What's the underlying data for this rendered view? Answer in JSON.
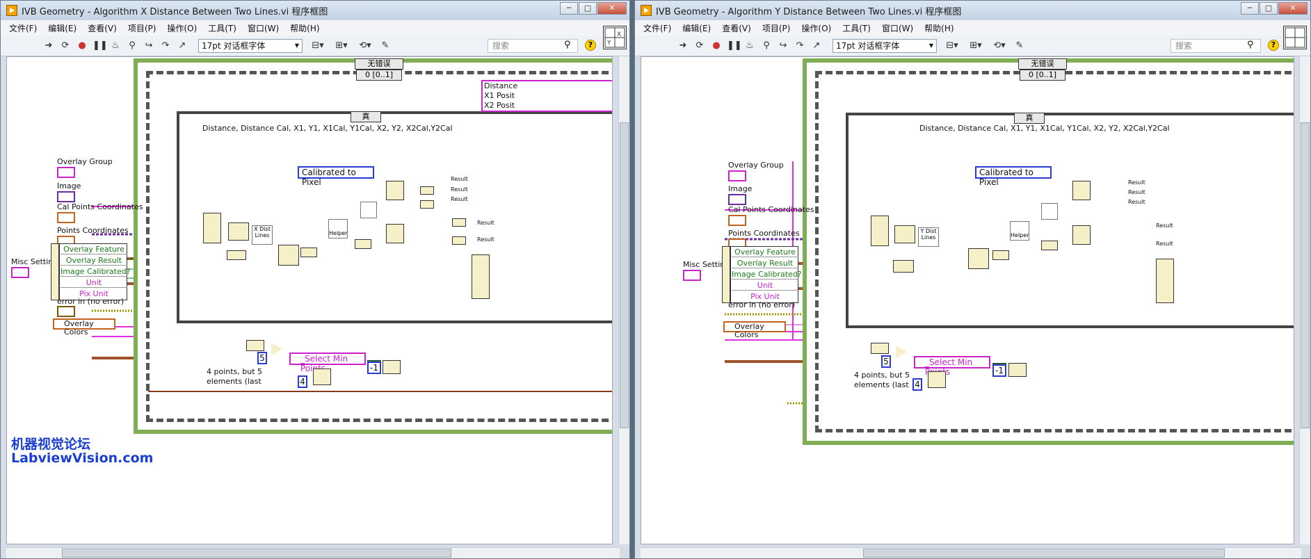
{
  "left": {
    "title": "IVB Geometry - Algorithm X Distance Between Two Lines.vi 程序框图",
    "dist_node_label": "X Dist Lines",
    "right_indicators": [
      "Distance",
      "X1 Posit",
      "X2 Posit"
    ]
  },
  "right": {
    "title": "IVB Geometry - Algorithm Y Distance Between Two Lines.vi 程序框图",
    "dist_node_label": "Y Dist Lines"
  },
  "window_buttons": {
    "minimize": "─",
    "maximize": "□",
    "close": "✕"
  },
  "menu": [
    "文件(F)",
    "编辑(E)",
    "查看(V)",
    "项目(P)",
    "操作(O)",
    "工具(T)",
    "窗口(W)",
    "帮助(H)"
  ],
  "toolbar": {
    "font": "17pt 对话框字体",
    "search_placeholder": "搜索"
  },
  "diagram": {
    "case_error": "无错误",
    "case_frame": "0 [0..1]",
    "case_true": "真",
    "cluster_label": "Distance, Distance Cal, X1, Y1, X1Cal, Y1Cal, X2, Y2, X2Cal,Y2Cal",
    "controls": {
      "overlay_group": "Overlay Group",
      "image": "Image",
      "cal_points": "Cal Points Coordinates",
      "points": "Points Coordinates",
      "misc": "Misc Setting",
      "error_in": "error in (no error)",
      "overlay_colors": "Overlay Colors"
    },
    "misc_items": [
      "Overlay Feature",
      "Overlay Result",
      "Image Calibrated?",
      "Unit",
      "Pix Unit"
    ],
    "ring": "Calibrated to Pixel",
    "helper": "Helper",
    "select_min": "_Select Min Points",
    "num5": "5",
    "num4": "4",
    "neg1": "-1",
    "comment": [
      "4 points, but 5",
      "elements (last"
    ],
    "result": "Result"
  },
  "watermark": {
    "line1": "机器视觉论坛",
    "line2": "LabviewVision.com"
  }
}
